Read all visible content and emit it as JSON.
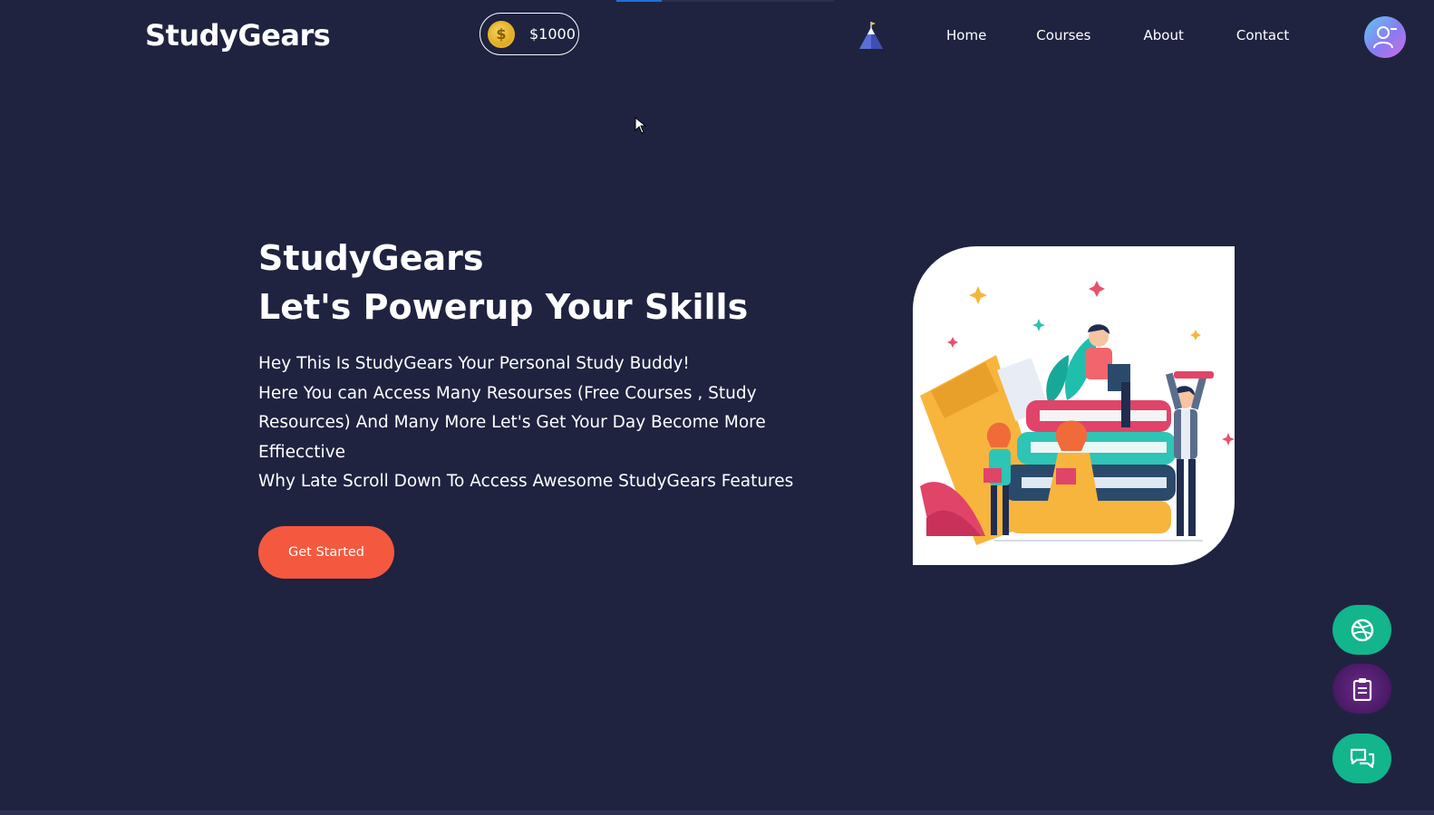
{
  "brand": {
    "name": "StudyGears"
  },
  "wallet": {
    "amount": "$1000",
    "coin_symbol": "$"
  },
  "nav": {
    "items": [
      {
        "label": "Home"
      },
      {
        "label": "Courses"
      },
      {
        "label": "About"
      },
      {
        "label": "Contact"
      }
    ]
  },
  "hero": {
    "title": "StudyGears",
    "subtitle": "Let's Powerup Your Skills",
    "lines": [
      "Hey This Is StudyGears Your Personal Study Buddy!",
      "Here You can Access Many Resourses (Free Courses , Study Resources) And Many More Let's Get Your Day Become More Effiecctive",
      "Why Late Scroll Down To Access Awesome StudyGears Features"
    ],
    "cta_label": "Get Started"
  },
  "colors": {
    "background": "#1f2340",
    "cta": "#f4593f",
    "fab_green": "#12b58c",
    "fab_purple": "#5a1f7a",
    "progress": "#1e6fd9"
  },
  "icons": {
    "mountain": "mountain-flag-icon",
    "avatar": "user-remove-icon",
    "fab1": "dribbble-icon",
    "fab2": "clipboard-icon",
    "fab3": "chat-icon"
  }
}
